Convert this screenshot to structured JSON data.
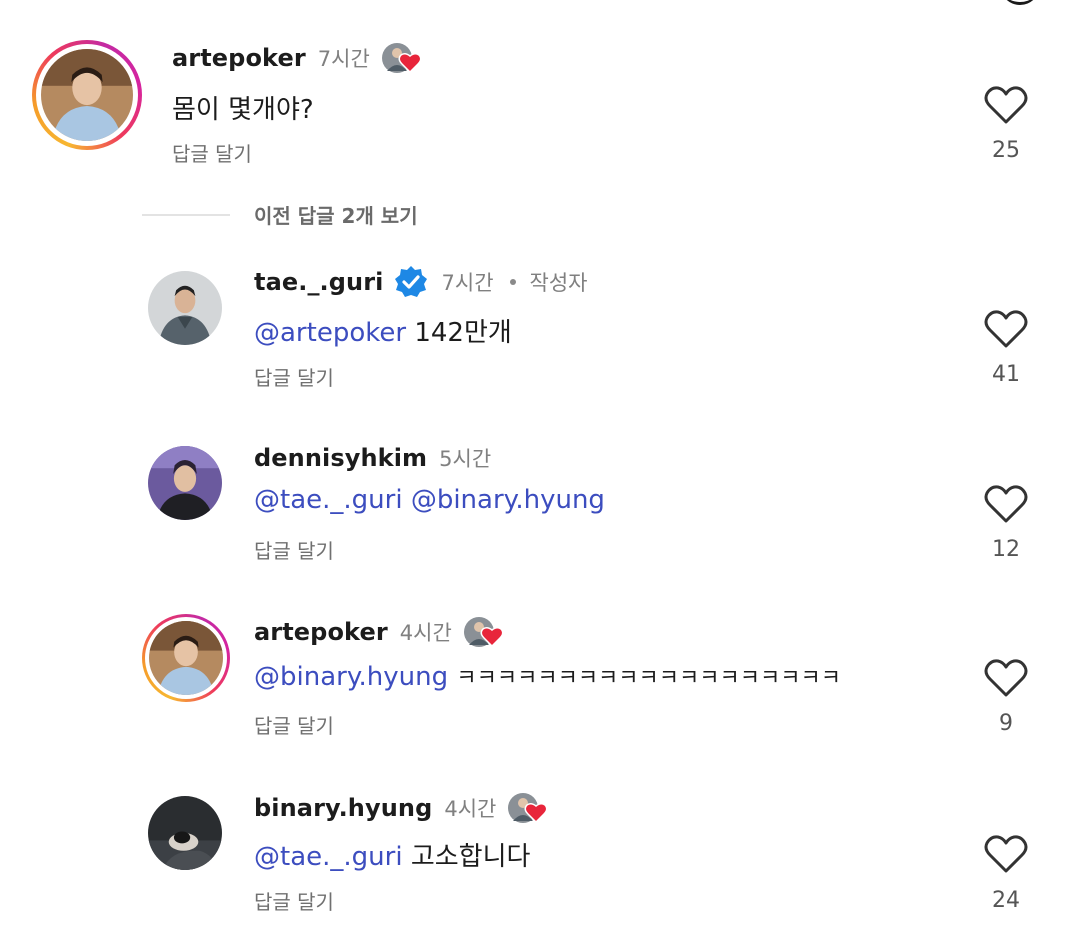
{
  "reply_label": "답글 달기",
  "view_previous_replies": "이전 답글 2개 보기",
  "colors": {
    "mention": "#3c4dbf",
    "verified": "#1e88e5",
    "heart_badge": "#e8253b"
  },
  "comments": [
    {
      "username": "artepoker",
      "time": "7시간",
      "badge": "liked-by-author-heart-icon",
      "has_story_ring": true,
      "mentions": [],
      "text": "몸이 몇개야?",
      "likes": "25"
    },
    {
      "username": "tae._.guri",
      "verified": true,
      "time": "7시간",
      "author_label": "작성자",
      "mentions": [
        "@artepoker"
      ],
      "text": "142만개",
      "likes": "41"
    },
    {
      "username": "dennisyhkim",
      "time": "5시간",
      "mentions": [
        "@tae._.guri",
        "@binary.hyung"
      ],
      "text": "",
      "likes": "12"
    },
    {
      "username": "artepoker",
      "time": "4시간",
      "badge": "liked-by-author-heart-icon",
      "has_story_ring": true,
      "mentions": [
        "@binary.hyung"
      ],
      "text": "ㅋㅋㅋㅋㅋㅋㅋㅋㅋㅋㅋㅋㅋㅋㅋㅋㅋㅋㅋ",
      "likes": "9"
    },
    {
      "username": "binary.hyung",
      "time": "4시간",
      "badge": "liked-by-author-heart-icon",
      "mentions": [
        "@tae._.guri"
      ],
      "text": "고소합니다",
      "likes": "24"
    }
  ]
}
